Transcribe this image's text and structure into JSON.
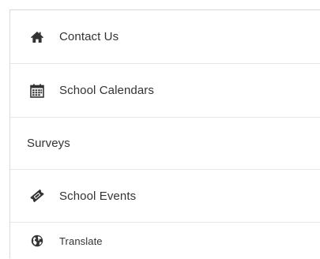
{
  "menu": {
    "items": [
      {
        "label": "Contact Us",
        "icon": "home-icon"
      },
      {
        "label": "School Calendars",
        "icon": "calendar-icon"
      },
      {
        "label": "Surveys",
        "icon": ""
      },
      {
        "label": "School Events",
        "icon": "ticket-icon"
      },
      {
        "label": "Translate",
        "icon": "globe-icon"
      }
    ]
  },
  "colors": {
    "text": "#333333",
    "icon": "#333333",
    "divider": "#e6e6e6",
    "border": "#d9d9d9"
  }
}
